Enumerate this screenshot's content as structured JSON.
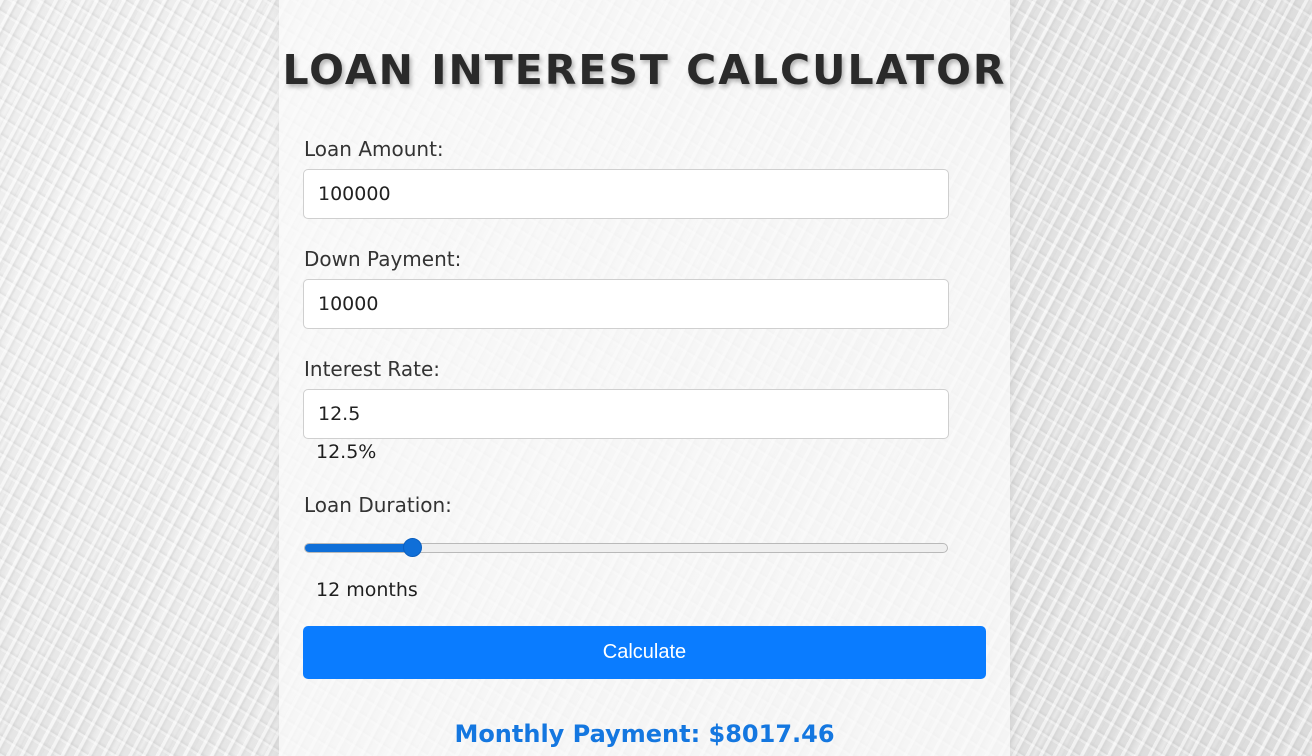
{
  "title": "LOAN INTEREST CALCULATOR",
  "fields": {
    "loan_amount": {
      "label": "Loan Amount:",
      "value": "100000"
    },
    "down_payment": {
      "label": "Down Payment:",
      "value": "10000"
    },
    "interest_rate": {
      "label": "Interest Rate:",
      "value": "12.5",
      "display": "12.5%"
    },
    "loan_duration": {
      "label": "Loan Duration:",
      "display": "12 months",
      "slider_fraction": 0.168
    }
  },
  "calculate_button": {
    "label": "Calculate"
  },
  "result": {
    "text": "Monthly Payment: $8017.46"
  },
  "colors": {
    "accent": "#0a7cff",
    "result_text": "#1477e0",
    "title_text": "#2a2a2a"
  }
}
